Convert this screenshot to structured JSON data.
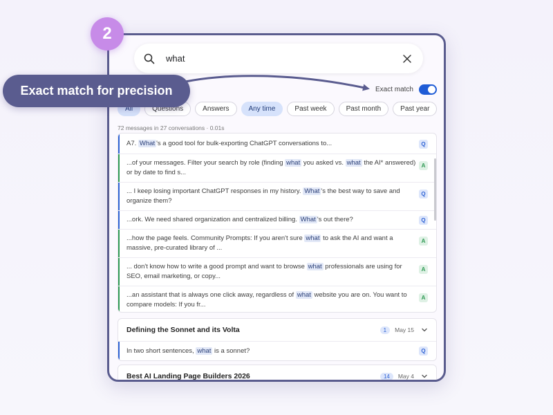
{
  "step": {
    "number": "2"
  },
  "callout": {
    "text": "Exact match for precision"
  },
  "search": {
    "value": "what",
    "icon": "search-icon",
    "clear_icon": "close-icon"
  },
  "exact_match": {
    "label": "Exact match",
    "enabled": true
  },
  "filters": [
    {
      "label": "All",
      "active": true
    },
    {
      "label": "Questions",
      "active": false
    },
    {
      "label": "Answers",
      "active": false
    },
    {
      "label": "Any time",
      "active": true
    },
    {
      "label": "Past week",
      "active": false
    },
    {
      "label": "Past month",
      "active": false
    },
    {
      "label": "Past year",
      "active": false
    }
  ],
  "summary": "72 messages in 27 conversations · 0.01s",
  "results": [
    {
      "role": "Q",
      "parts": [
        "A7. ",
        "What",
        "'s a good tool for bulk-exporting ChatGPT conversations to..."
      ]
    },
    {
      "role": "A",
      "parts": [
        "...of your messages. Filter your search by role (finding ",
        "what",
        " you asked vs. ",
        "what",
        " the AI* answered) or by date to find s..."
      ]
    },
    {
      "role": "Q",
      "parts": [
        "... I keep losing important ChatGPT responses in my history. ",
        "What",
        "'s the best way to save and organize them?"
      ]
    },
    {
      "role": "Q",
      "parts": [
        "...ork. We need shared organization and centralized billing. ",
        "What",
        "'s out there?"
      ]
    },
    {
      "role": "A",
      "parts": [
        "...how the page feels. Community Prompts: If you aren't sure ",
        "what",
        " to ask the AI and want a massive, pre-curated library of ..."
      ]
    },
    {
      "role": "A",
      "parts": [
        "... don't know how to write a good prompt and want to browse ",
        "what",
        " professionals are using for SEO, email marketing, or copy..."
      ]
    },
    {
      "role": "A",
      "parts": [
        "...an assistant that is always one click away, regardless of ",
        "what",
        " website you are on. You want to compare models: If you fr..."
      ]
    }
  ],
  "conversations": [
    {
      "title": "Defining the Sonnet and its Volta",
      "count": "1",
      "date": "May 15",
      "snippet": {
        "role": "Q",
        "parts": [
          "In two short sentences, ",
          "what",
          " is a sonnet?"
        ]
      }
    },
    {
      "title": "Best AI Landing Page Builders 2026",
      "count": "14",
      "date": "May 4"
    }
  ],
  "colors": {
    "accent": "#1f5cd6",
    "question": "#2f63d4",
    "answer": "#2f9a54",
    "callout": "#5a5c8f",
    "badge": "#c78be8",
    "frame": "#5a5c8e"
  }
}
